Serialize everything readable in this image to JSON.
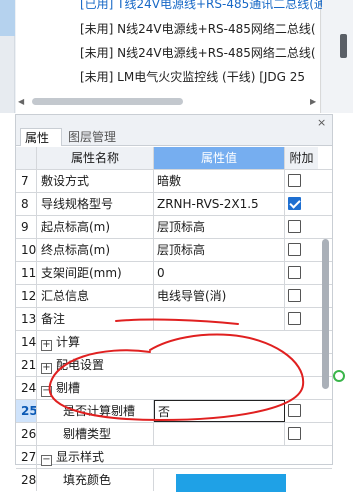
{
  "drawing_list": {
    "items": [
      {
        "label": "[已用] T线24V电源线+RS-485通讯二总线(通"
      },
      {
        "label": "[未用] N线24V电源线+RS-485网络二总线("
      },
      {
        "label": "[未用] N线24V电源线+RS-485网络二总线("
      },
      {
        "label": "[未用] LM电气火灾监控线 (干线) [JDG 25"
      },
      {
        "label": "  ..."
      }
    ]
  },
  "panel": {
    "tabs": [
      {
        "label": "属性"
      },
      {
        "label": "图层管理"
      }
    ],
    "close_label": "×",
    "headers": {
      "name": "属性名称",
      "value": "属性值",
      "add": "附加"
    }
  },
  "properties": [
    {
      "idx": "7",
      "name": "敷设方式",
      "value": "暗敷",
      "checked": false
    },
    {
      "idx": "8",
      "name": "导线规格型号",
      "value": "ZRNH-RVS-2X1.5",
      "checked": true
    },
    {
      "idx": "9",
      "name": "起点标高(m)",
      "value": "层顶标高",
      "checked": false
    },
    {
      "idx": "10",
      "name": "终点标高(m)",
      "value": "层顶标高",
      "checked": false
    },
    {
      "idx": "11",
      "name": "支架间距(mm)",
      "value": "0",
      "checked": false
    },
    {
      "idx": "12",
      "name": "汇总信息",
      "value": "电线导管(消)",
      "checked": false
    },
    {
      "idx": "13",
      "name": "备注",
      "value": "",
      "checked": false
    }
  ],
  "groups": [
    {
      "idx": "14",
      "label": "计算",
      "sign": "+"
    },
    {
      "idx": "21",
      "label": "配电设置",
      "sign": "+"
    },
    {
      "idx": "24",
      "label": "剔槽",
      "sign": "−"
    }
  ],
  "sub_properties": [
    {
      "idx": "25",
      "name": "是否计算剔槽",
      "value": "否",
      "checked": false
    },
    {
      "idx": "26",
      "name": "剔槽类型",
      "value": "",
      "checked": false
    }
  ],
  "display_group": {
    "idx": "27",
    "label": "显示样式",
    "sign": "−"
  },
  "fill_row": {
    "idx": "28",
    "name": "填充颜色",
    "color": "#1fa1e6"
  },
  "colors": {
    "accent": "#76aef0",
    "selected_text": "#0c5ab5",
    "annotation": "#e02020"
  }
}
